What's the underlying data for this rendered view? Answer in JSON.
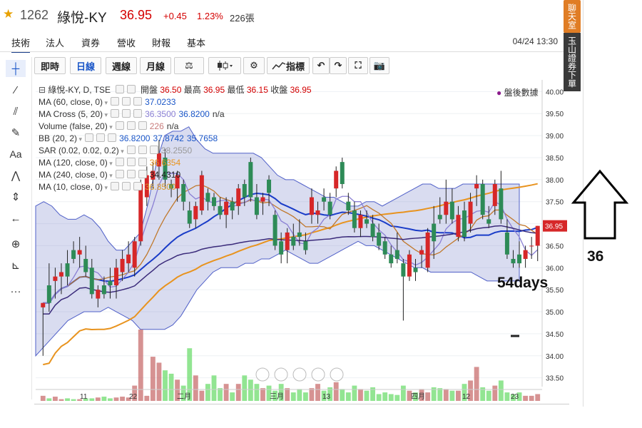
{
  "header": {
    "code": "1262",
    "name": "綠悅-KY",
    "price": "36.95",
    "change": "+0.45",
    "change_pct": "1.23%",
    "volume": "226張"
  },
  "tabs": [
    {
      "label": "技術",
      "active": true
    },
    {
      "label": "法人"
    },
    {
      "label": "資券"
    },
    {
      "label": "營收"
    },
    {
      "label": "財報"
    },
    {
      "label": "基本"
    }
  ],
  "timestamp": "04/24 13:30",
  "toolbar": {
    "intraday": "即時",
    "daily": "日線",
    "weekly": "週線",
    "monthly": "月線",
    "indicators": "指標"
  },
  "right_panel": {
    "chat": "聊天室",
    "order": "玉山證券下單"
  },
  "legend": {
    "symbol": "綠悅-KY, D, TSE",
    "open_label": "開盤",
    "open": "36.50",
    "high_label": "最高",
    "high": "36.95",
    "low_label": "最低",
    "low": "36.15",
    "close_label": "收盤",
    "close": "36.95",
    "after_hours": "盤後數據",
    "lines": [
      {
        "name": "MA (60, close, 0)",
        "vals": [
          "37.0233"
        ],
        "colors": [
          "#1a56c8"
        ]
      },
      {
        "name": "MA Cross (5, 20)",
        "vals": [
          "36.3500",
          "36.8200",
          "n/a"
        ],
        "colors": [
          "#8a7fd4",
          "#1a56c8",
          "#333333"
        ]
      },
      {
        "name": "Volume (false, 20)",
        "vals": [
          "226",
          "n/a"
        ],
        "colors": [
          "#c87c7c",
          "#333333"
        ]
      },
      {
        "name": "BB (20, 2)",
        "vals": [
          "36.8200",
          "37.8742",
          "35.7658"
        ],
        "colors": [
          "#1a56c8",
          "#1a56c8",
          "#1a56c8"
        ]
      },
      {
        "name": "SAR (0.02, 0.02, 0.2)",
        "vals": [
          "38.2550"
        ],
        "colors": [
          "#999999"
        ]
      },
      {
        "name": "MA (120, close, 0)",
        "vals": [
          "36.6354"
        ],
        "colors": [
          "#e8931e"
        ]
      },
      {
        "name": "MA (240, close, 0)",
        "vals": [
          "34.4310"
        ],
        "colors": [
          "#222222"
        ]
      },
      {
        "name": "MA (10, close, 0)",
        "vals": [
          "36.8500"
        ],
        "colors": [
          "#d99a2b"
        ]
      }
    ]
  },
  "annotations": {
    "level": "36",
    "days": "54days"
  },
  "chart_data": {
    "type": "candlestick",
    "y_ticks": [
      "40.00",
      "39.50",
      "39.00",
      "38.50",
      "38.00",
      "37.50",
      "37.00",
      "36.50",
      "36.00",
      "35.50",
      "35.00",
      "34.50",
      "34.00",
      "33.50"
    ],
    "ylim": [
      33.3,
      40.2
    ],
    "x_labels": [
      "11",
      "22",
      "二月",
      "三月",
      "13",
      "四月",
      "12",
      "23"
    ],
    "last_price": "36.95",
    "up_color": "#d62728",
    "down_color": "#2e8b57",
    "candles": [
      [
        35.1,
        35.2,
        34.0,
        35.2
      ],
      [
        35.6,
        36.1,
        35.0,
        35.2
      ],
      [
        35.7,
        36.0,
        35.3,
        35.8
      ],
      [
        35.8,
        36.1,
        35.4,
        35.9
      ],
      [
        36.1,
        36.4,
        35.6,
        35.8
      ],
      [
        36.4,
        36.6,
        36.1,
        36.2
      ],
      [
        36.3,
        36.7,
        36.0,
        36.4
      ],
      [
        36.2,
        36.5,
        35.8,
        35.9
      ],
      [
        36.0,
        36.2,
        35.3,
        35.4
      ],
      [
        35.3,
        35.6,
        35.1,
        35.5
      ],
      [
        35.6,
        35.8,
        35.3,
        35.4
      ],
      [
        35.7,
        36.0,
        35.3,
        35.6
      ],
      [
        35.6,
        36.2,
        35.3,
        36.0
      ],
      [
        35.9,
        36.4,
        35.7,
        36.2
      ],
      [
        36.1,
        36.6,
        35.9,
        36.3
      ],
      [
        36.0,
        36.7,
        35.8,
        36.6
      ],
      [
        36.6,
        38.0,
        36.5,
        37.9
      ],
      [
        37.6,
        38.3,
        37.4,
        38.1
      ],
      [
        38.0,
        38.4,
        37.8,
        38.2
      ],
      [
        38.3,
        38.9,
        38.0,
        38.6
      ],
      [
        38.5,
        38.7,
        37.8,
        38.0
      ],
      [
        37.9,
        38.0,
        37.6,
        37.8
      ],
      [
        37.8,
        38.2,
        37.5,
        38.1
      ],
      [
        37.9,
        38.0,
        37.3,
        37.5
      ],
      [
        37.3,
        37.5,
        36.9,
        37.0
      ],
      [
        37.1,
        37.5,
        36.9,
        37.4
      ],
      [
        37.3,
        38.2,
        37.2,
        38.1
      ],
      [
        37.7,
        37.8,
        37.3,
        37.5
      ],
      [
        37.6,
        37.7,
        37.3,
        37.4
      ],
      [
        37.4,
        37.6,
        37.1,
        37.2
      ],
      [
        37.2,
        37.6,
        36.9,
        37.5
      ],
      [
        37.5,
        37.6,
        37.1,
        37.3
      ],
      [
        37.4,
        37.9,
        37.2,
        37.8
      ],
      [
        37.9,
        38.0,
        37.4,
        37.6
      ],
      [
        38.4,
        38.5,
        37.5,
        37.6
      ],
      [
        37.6,
        37.9,
        37.1,
        37.2
      ],
      [
        37.5,
        37.7,
        37.2,
        37.6
      ],
      [
        38.0,
        38.1,
        37.4,
        37.7
      ],
      [
        37.2,
        37.3,
        36.4,
        36.5
      ],
      [
        36.6,
        36.8,
        36.1,
        36.3
      ],
      [
        36.4,
        36.9,
        36.1,
        36.8
      ],
      [
        36.7,
        37.0,
        36.4,
        36.5
      ],
      [
        36.8,
        37.1,
        36.5,
        36.7
      ],
      [
        36.6,
        36.8,
        36.3,
        36.4
      ],
      [
        37.2,
        37.8,
        37.0,
        37.6
      ],
      [
        37.2,
        37.5,
        37.0,
        37.3
      ],
      [
        37.6,
        37.8,
        37.3,
        37.5
      ],
      [
        37.5,
        37.7,
        37.1,
        37.2
      ],
      [
        37.8,
        38.3,
        37.6,
        38.2
      ],
      [
        38.4,
        38.5,
        37.8,
        37.9
      ],
      [
        37.5,
        37.7,
        37.2,
        37.3
      ],
      [
        37.3,
        37.5,
        36.8,
        36.9
      ],
      [
        36.9,
        37.3,
        36.7,
        37.2
      ],
      [
        37.1,
        37.3,
        36.9,
        37.0
      ],
      [
        37.0,
        37.2,
        36.6,
        36.7
      ],
      [
        36.8,
        37.0,
        36.4,
        36.5
      ],
      [
        36.6,
        36.7,
        36.2,
        36.3
      ],
      [
        36.3,
        36.5,
        36.0,
        36.1
      ],
      [
        36.4,
        36.8,
        36.1,
        36.2
      ],
      [
        36.1,
        36.2,
        34.8,
        35.8
      ],
      [
        35.8,
        36.4,
        35.7,
        36.3
      ],
      [
        36.0,
        36.2,
        35.7,
        35.9
      ],
      [
        36.3,
        36.5,
        36.0,
        36.4
      ],
      [
        36.0,
        36.9,
        35.9,
        36.8
      ],
      [
        37.0,
        37.4,
        36.2,
        36.6
      ],
      [
        37.2,
        37.6,
        37.0,
        37.1
      ],
      [
        37.2,
        38.0,
        37.0,
        37.5
      ],
      [
        37.5,
        37.8,
        37.0,
        37.1
      ],
      [
        36.7,
        37.4,
        36.6,
        37.2
      ],
      [
        37.3,
        37.5,
        36.6,
        36.7
      ],
      [
        37.0,
        37.7,
        36.8,
        37.5
      ],
      [
        37.8,
        38.1,
        37.4,
        37.9
      ],
      [
        37.9,
        38.0,
        37.1,
        37.2
      ],
      [
        37.1,
        37.4,
        36.9,
        37.0
      ],
      [
        37.4,
        38.0,
        37.2,
        37.9
      ],
      [
        37.8,
        38.2,
        37.0,
        37.1
      ],
      [
        36.8,
        37.1,
        36.2,
        36.3
      ],
      [
        36.2,
        36.4,
        36.0,
        36.1
      ],
      [
        36.3,
        36.6,
        36.0,
        36.1
      ],
      [
        36.2,
        36.5,
        36.0,
        36.4
      ],
      [
        36.5,
        36.7,
        36.2,
        36.5
      ],
      [
        36.5,
        36.95,
        36.15,
        36.95
      ]
    ],
    "volume": [
      6,
      3,
      5,
      2,
      3,
      2,
      2,
      3,
      3,
      4,
      5,
      3,
      4,
      5,
      4,
      18,
      84,
      6,
      52,
      45,
      36,
      32,
      25,
      18,
      62,
      30,
      12,
      20,
      30,
      15,
      20,
      10,
      20,
      30,
      25,
      20,
      15,
      18,
      12,
      20,
      15,
      10,
      14,
      10,
      15,
      20,
      12,
      16,
      22,
      14,
      10,
      18,
      14,
      12,
      16,
      8,
      10,
      8,
      7,
      18,
      12,
      10,
      14,
      10,
      16,
      15,
      14,
      12,
      12,
      20,
      24,
      40,
      16,
      12,
      18,
      24,
      10,
      8,
      10,
      6,
      6,
      8
    ],
    "bb_upper": [
      37.4,
      37.5,
      37.4,
      37.2,
      37.1,
      37.1,
      37.2,
      37.1,
      36.9,
      36.6,
      36.4,
      36.4,
      36.6,
      36.8,
      37.5,
      38.4,
      39.0,
      39.1,
      39.1,
      39.2,
      38.9,
      38.7,
      38.6,
      38.6,
      38.6,
      38.6,
      38.6,
      38.6,
      38.5,
      38.3,
      38.1,
      38.0,
      38.0,
      37.9,
      37.8,
      37.7,
      37.6,
      37.6,
      37.5,
      37.4,
      37.4,
      37.5,
      37.5,
      37.4,
      37.5,
      37.6,
      37.7,
      37.8,
      37.9,
      37.9,
      37.8,
      37.8,
      37.8,
      37.9,
      37.9,
      37.9,
      37.9,
      37.9,
      37.9,
      37.9,
      37.9
    ],
    "bb_lower": [
      34.0,
      34.2,
      34.4,
      34.6,
      34.8,
      34.9,
      35.0,
      35.0,
      35.0,
      35.1,
      35.0,
      34.9,
      34.8,
      34.6,
      34.6,
      34.6,
      34.6,
      34.7,
      34.9,
      35.2,
      35.5,
      35.7,
      35.9,
      36.0,
      36.0,
      36.0,
      36.1,
      36.1,
      36.2,
      36.2,
      36.3,
      36.4,
      36.3,
      36.2,
      36.1,
      36.1,
      36.2,
      36.3,
      36.4,
      36.5,
      36.6,
      36.5,
      36.5,
      36.4,
      36.3,
      36.2,
      36.1,
      36.0,
      36.0,
      35.9,
      35.9,
      35.9,
      35.9,
      35.9,
      35.9,
      35.8,
      35.7,
      35.7,
      35.7,
      35.7,
      35.7
    ]
  }
}
